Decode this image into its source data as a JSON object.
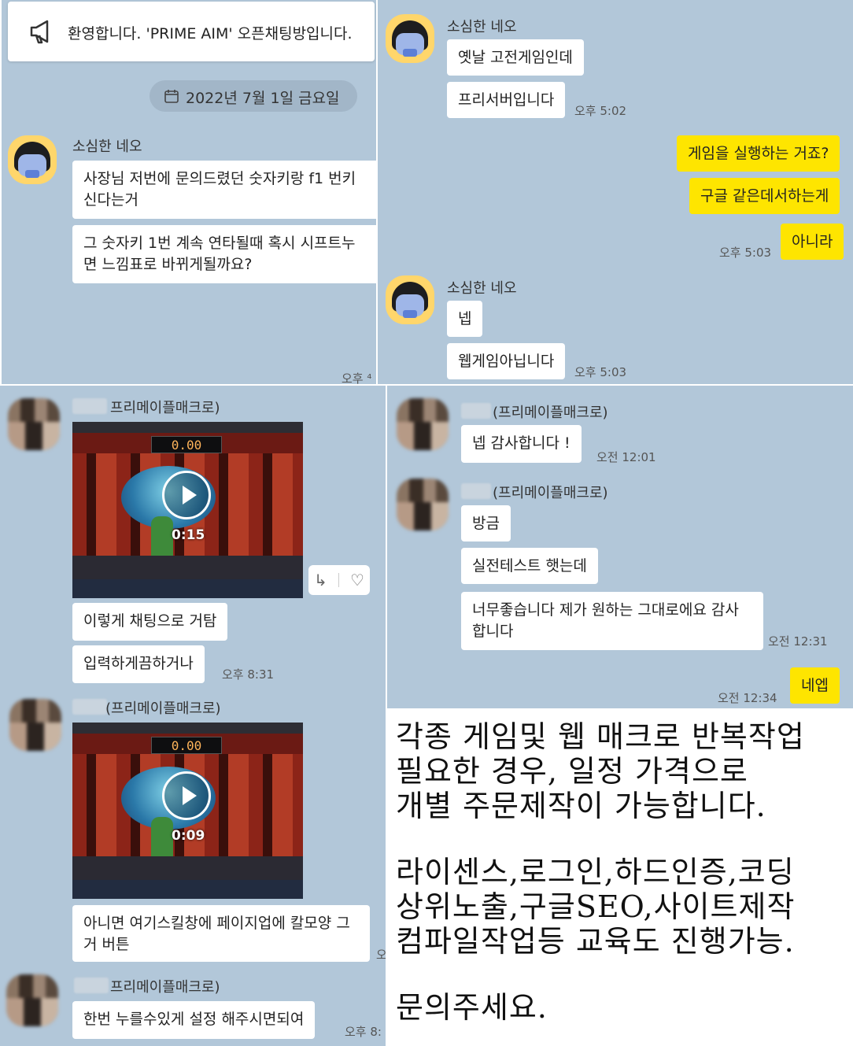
{
  "panel1": {
    "notice": {
      "icon": "megaphone-icon",
      "text": "환영합니다. 'PRIME AIM' 오픈채팅방입니다."
    },
    "date_chip": {
      "icon": "calendar-icon",
      "text": "2022년 7월 1일 금요일"
    },
    "sender": "소심한 네오",
    "messages": [
      "사장님 저번에 문의드렸던 숫자키랑 f1 번키 신다는거",
      "그 숫자키 1번 계속 연타될때 혹시 시프트누 면 느낌표로 바뀌게될까요?"
    ],
    "time_partial": "오후 ⁴"
  },
  "panel2": {
    "sender": "소심한 네오",
    "msgs_a": [
      "옛날 고전게임인데",
      "프리서버입니다"
    ],
    "time_a": "오후 5:02",
    "my_msgs": [
      "게임을 실행하는 거죠?",
      "구글 같은데서하는게",
      "아니라"
    ],
    "my_time": "오후 5:03",
    "sender_b": "소심한 네오",
    "msgs_b": [
      "넵",
      "웹게임아닙니다"
    ],
    "time_b": "오후 5:03"
  },
  "panel3": {
    "sender_1": "프리메이플매크로)",
    "video_1": {
      "hud": "0.00",
      "duration": "0:15"
    },
    "msgs_1": [
      "이렇게 채팅으로 거탐",
      "입력하게끔하거나"
    ],
    "time_1": "오후 8:31",
    "sender_2": "(프리메이플매크로)",
    "video_2": {
      "hud": "0.00",
      "duration": "0:09"
    },
    "msg_2": "아니면 여기스킬창에 페이지업에 칼모양 그거 버튼",
    "time_2_partial": "오",
    "sender_3": "프리메이플매크로)",
    "msg_3": "한번 누를수있게 설정 해주시면되여",
    "time_3_partial": "오후 8:"
  },
  "panel4": {
    "sender_1": "(프리메이플매크로)",
    "msg_1": "넵 감사합니다 !",
    "time_1": "오전 12:01",
    "sender_2": "(프리메이플매크로)",
    "msgs_2": [
      "방금",
      "실전테스트 햇는데",
      "너무좋습니다 제가 원하는 그대로에요 감사합니다"
    ],
    "time_2": "오전 12:31",
    "my_msg": "네엡",
    "my_time": "오전 12:34"
  },
  "ad": {
    "lines_1": [
      "각종 게임및 웹 매크로 반복작업",
      "필요한 경우, 일정 가격으로",
      "개별 주문제작이 가능합니다."
    ],
    "lines_2": [
      "라이센스,로그인,하드인증,코딩",
      "상위노출,구글SEO,사이트제작",
      "컴파일작업등 교육도 진행가능."
    ],
    "lines_3": [
      "문의주세요."
    ]
  },
  "colors": {
    "chat_bg": "#b2c7d9",
    "my_bubble": "#fee500",
    "other_bubble": "#ffffff"
  }
}
